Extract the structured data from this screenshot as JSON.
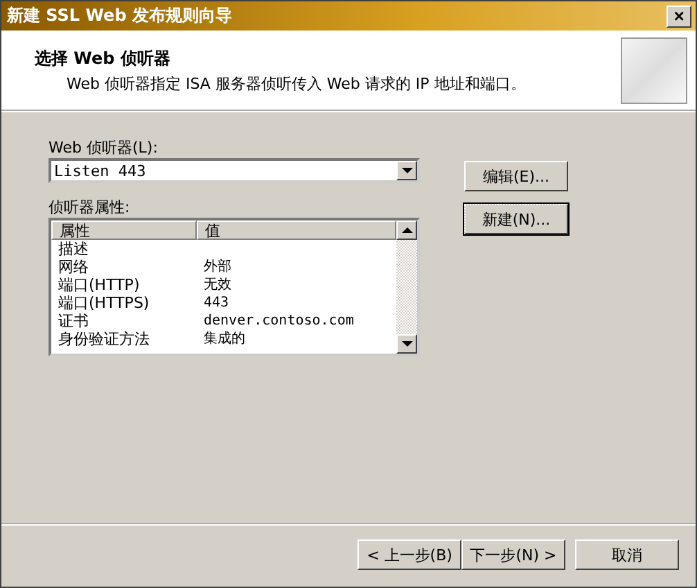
{
  "window": {
    "title": "新建 SSL Web 发布规则向导",
    "close": "×"
  },
  "header": {
    "title": "选择 Web 侦听器",
    "description": "Web 侦听器指定 ISA 服务器侦听传入 Web 请求的 IP 地址和端口。"
  },
  "listener": {
    "label": "Web 侦听器(L):",
    "value": "Listen 443"
  },
  "side_buttons": [
    {
      "label": "编辑(E)...",
      "focused": false
    },
    {
      "label": "新建(N)...",
      "focused": true
    }
  ],
  "properties": {
    "label": "侦听器属性:",
    "columns": [
      "属性",
      "值"
    ],
    "rows": [
      [
        "描述",
        ""
      ],
      [
        "网络",
        "外部"
      ],
      [
        "端口(HTTP)",
        "无效"
      ],
      [
        "端口(HTTPS)",
        "443"
      ],
      [
        "证书",
        "denver.contoso.com"
      ],
      [
        "身份验证方法",
        "集成的"
      ]
    ]
  },
  "footer_buttons": [
    {
      "label": "< 上一步(B)"
    },
    {
      "label": "下一步(N) >"
    },
    {
      "label": "取消"
    }
  ]
}
